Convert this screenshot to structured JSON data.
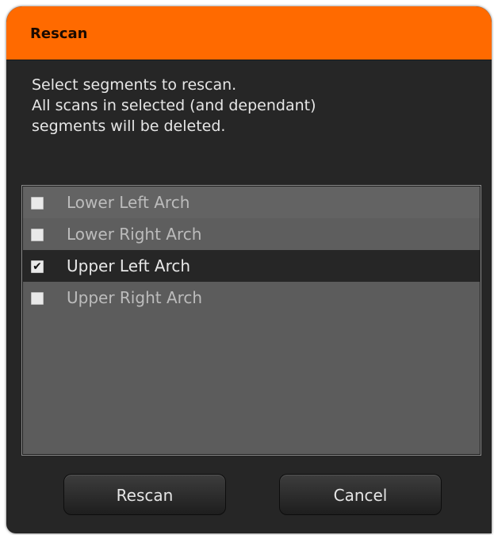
{
  "dialog": {
    "title": "Rescan",
    "title_bar_color": "#ff6a00",
    "message_lines": [
      "Select segments to rescan.",
      "All scans in selected (and dependant)",
      "segments will be deleted."
    ]
  },
  "segments": [
    {
      "label": "Lower Left Arch",
      "checked": false,
      "mark": ""
    },
    {
      "label": "Lower Right Arch",
      "checked": false,
      "mark": ""
    },
    {
      "label": "Upper Left Arch",
      "checked": true,
      "mark": "✔"
    },
    {
      "label": "Upper Right Arch",
      "checked": false,
      "mark": ""
    }
  ],
  "buttons": {
    "rescan_label": "Rescan",
    "cancel_label": "Cancel"
  }
}
